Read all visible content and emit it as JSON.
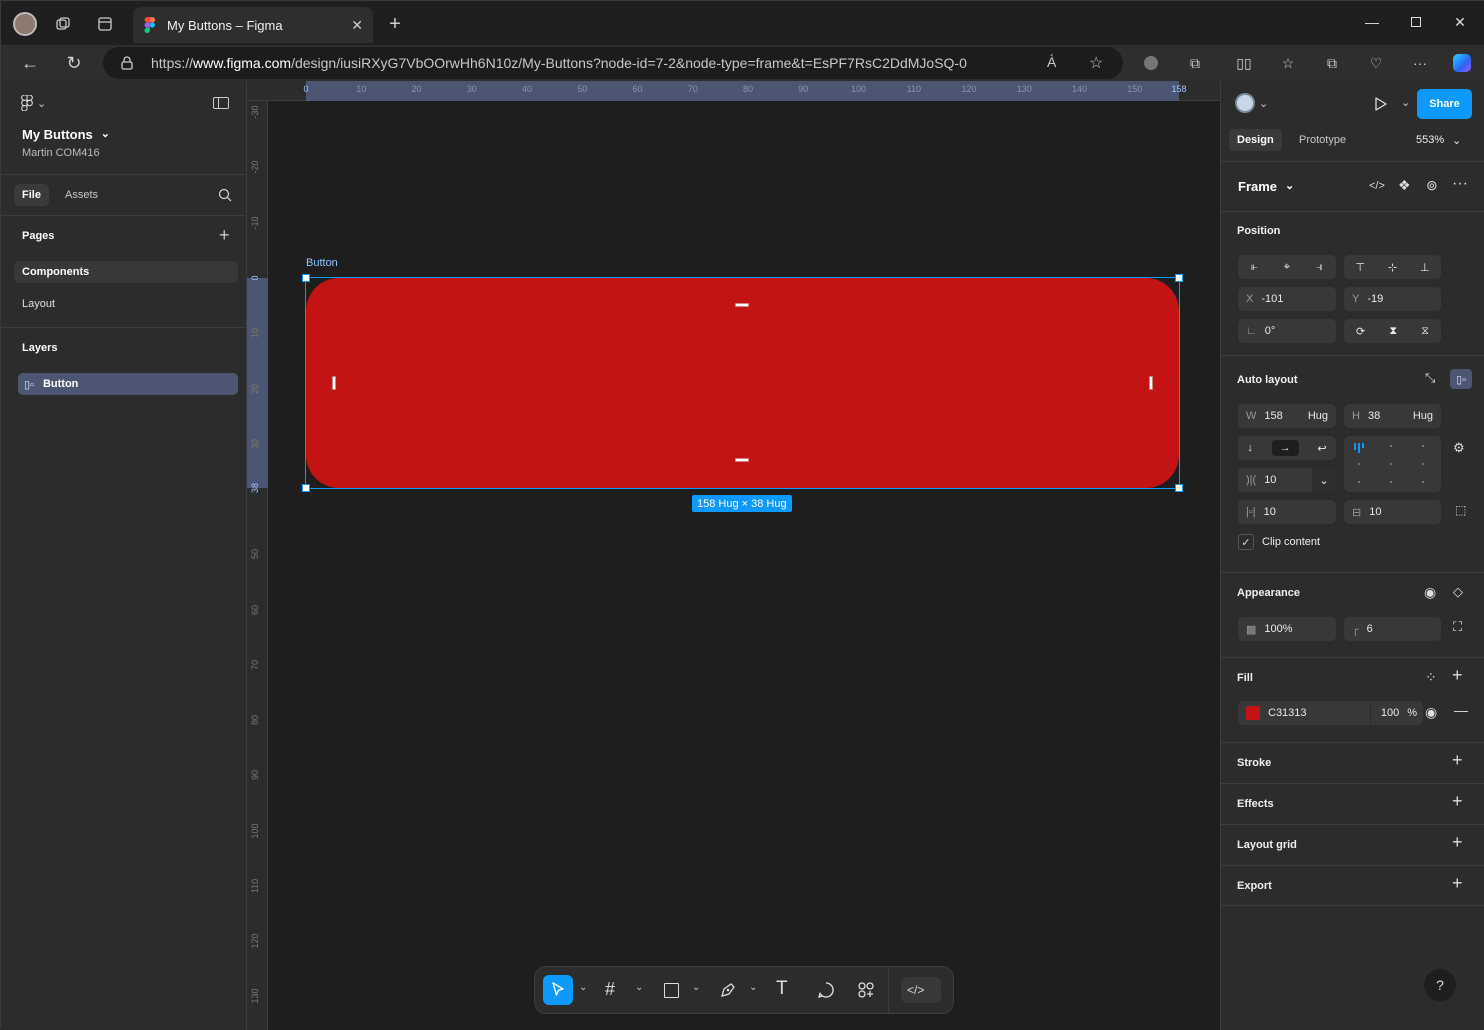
{
  "browser": {
    "tab_title": "My Buttons – Figma",
    "url_prefix": "https://",
    "url_host": "www.figma.com",
    "url_path": "/design/iusiRXyG7VbOOrwHh6N10z/My-Buttons?node-id=7-2&node-type=frame&t=EsPF7RsC2DdMJoSQ-0"
  },
  "left": {
    "file_name": "My Buttons",
    "team": "Martin COM416",
    "tab_file": "File",
    "tab_assets": "Assets",
    "pages_title": "Pages",
    "pages": [
      "Components",
      "Layout"
    ],
    "layers_title": "Layers",
    "layers": [
      "Button"
    ]
  },
  "canvas": {
    "frame_label": "Button",
    "size_badge": "158 Hug × 38 Hug",
    "ruler_h": [
      "0",
      "10",
      "20",
      "30",
      "40",
      "50",
      "60",
      "70",
      "80",
      "90",
      "100",
      "110",
      "120",
      "130",
      "140",
      "150",
      "158"
    ],
    "ruler_v": [
      "-30",
      "-20",
      "-10",
      "0",
      "10",
      "20",
      "30",
      "38",
      "50",
      "60",
      "70",
      "80",
      "90",
      "100",
      "110",
      "120",
      "130"
    ],
    "fill_color": "#C31313"
  },
  "right": {
    "share": "Share",
    "tab_design": "Design",
    "tab_prototype": "Prototype",
    "zoom": "553%",
    "frame_title": "Frame",
    "position_title": "Position",
    "x_label": "X",
    "x_value": "-101",
    "y_label": "Y",
    "y_value": "-19",
    "rotation": "0°",
    "autolayout_title": "Auto layout",
    "w_label": "W",
    "w_value": "158",
    "w_mode": "Hug",
    "h_label": "H",
    "h_value": "38",
    "h_mode": "Hug",
    "gap": "10",
    "padding_h": "10",
    "padding_v": "10",
    "clip_content": "Clip content",
    "appearance_title": "Appearance",
    "opacity": "100%",
    "radius": "6",
    "fill_title": "Fill",
    "fill_hex": "C31313",
    "fill_opacity": "100",
    "fill_pct": "%",
    "stroke_title": "Stroke",
    "effects_title": "Effects",
    "layout_grid_title": "Layout grid",
    "export_title": "Export",
    "help": "?"
  },
  "colors": {
    "accent": "#0d99ff",
    "fill": "#C31313"
  }
}
